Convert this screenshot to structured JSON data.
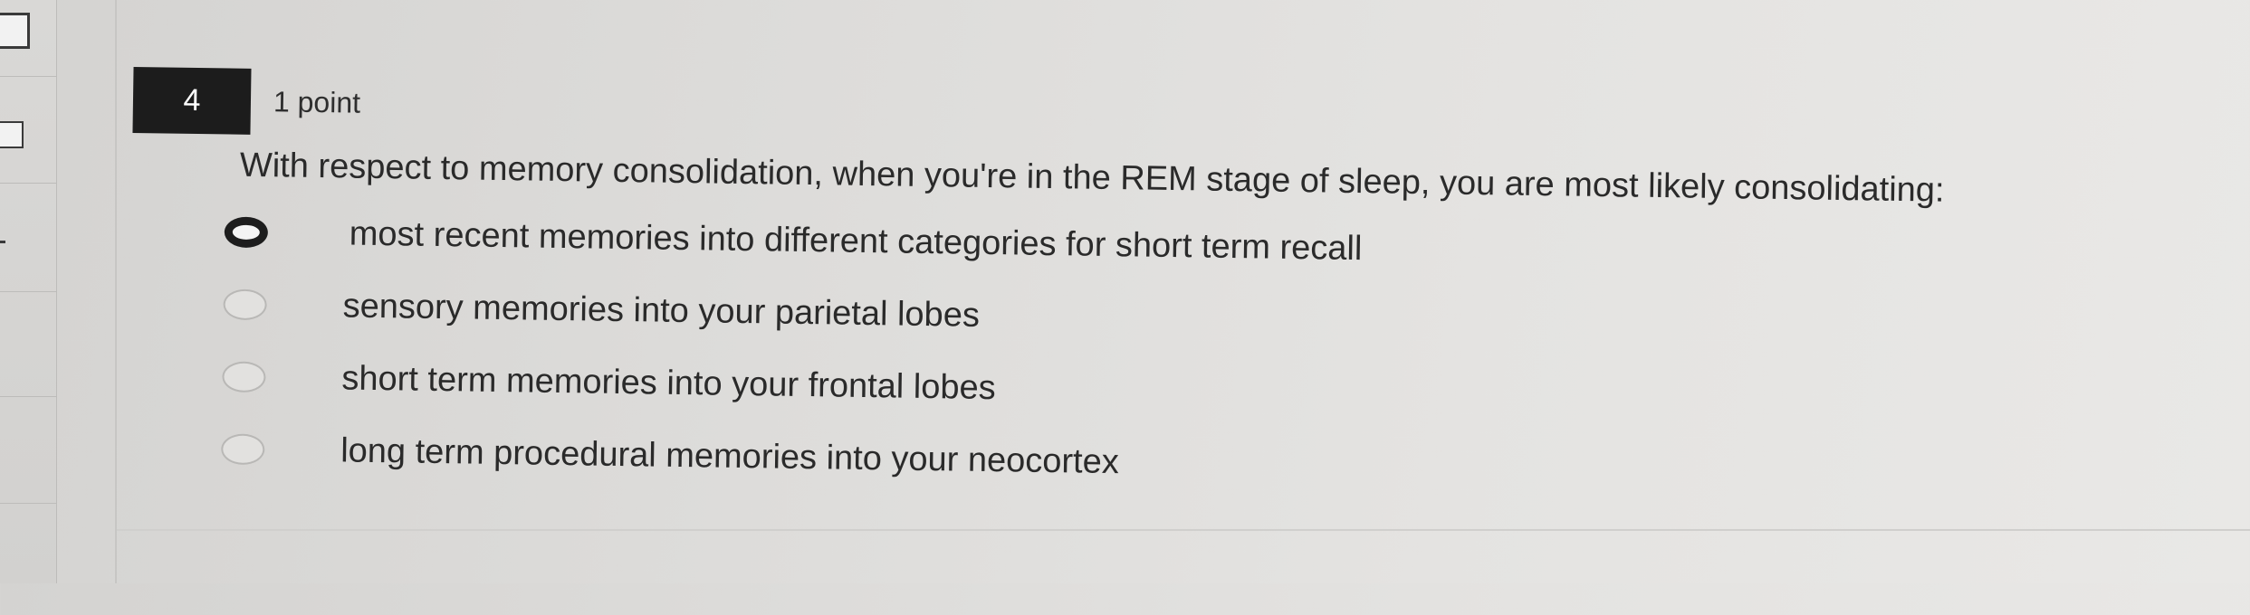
{
  "question": {
    "number": "4",
    "points": "1 point",
    "text": "With respect to memory consolidation, when you're in the REM stage of sleep, you are most likely consolidating:",
    "options": [
      {
        "label": "most recent memories into different categories for short term recall",
        "selected": true
      },
      {
        "label": "sensory memories into your parietal lobes",
        "selected": false
      },
      {
        "label": "short term memories into your frontal lobes",
        "selected": false
      },
      {
        "label": "long term procedural memories into your neocortex",
        "selected": false
      }
    ]
  }
}
